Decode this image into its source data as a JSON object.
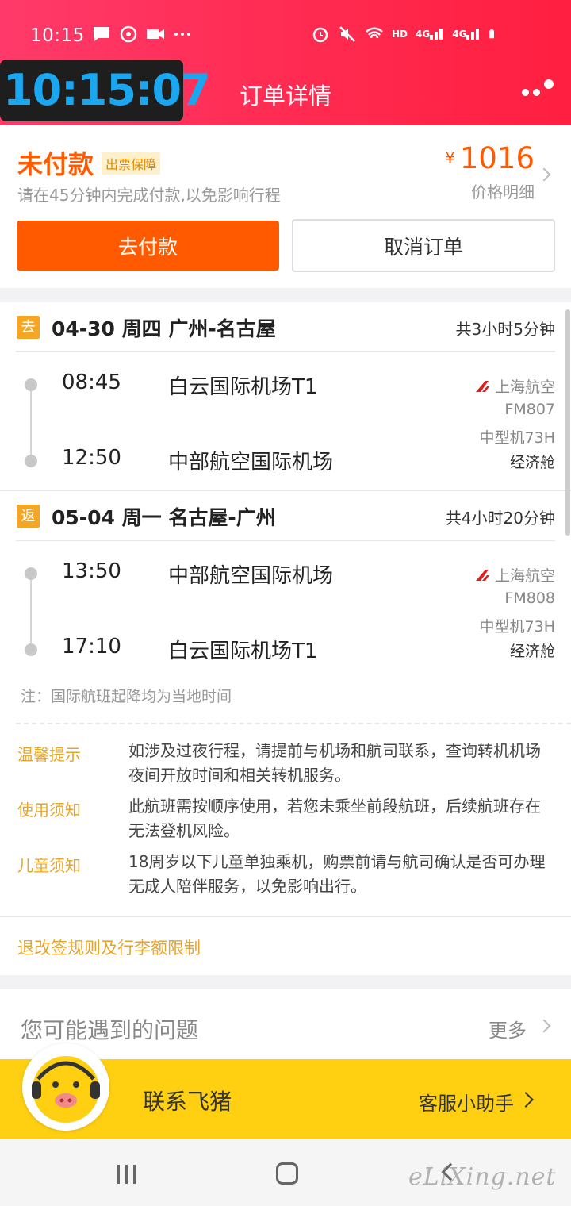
{
  "status_bar": {
    "time": "10:15",
    "network_hd": "HD",
    "network_4g_1": "4G",
    "network_4g_2": "4G"
  },
  "clock_overlay": "10:15:07",
  "header": {
    "title": "订单详情"
  },
  "order_status": {
    "title": "未付款",
    "badge": "出票保障",
    "subtitle": "请在45分钟内完成付款,以免影响行程",
    "currency": "¥",
    "price": "1016",
    "price_detail": "价格明细",
    "pay_button": "去付款",
    "cancel_button": "取消订单"
  },
  "legs": [
    {
      "tag": "去",
      "title": "04-30 周四 广州-名古屋",
      "duration": "共3小时5分钟",
      "depart_time": "08:45",
      "depart_airport": "白云国际机场T1",
      "arrive_time": "12:50",
      "arrive_airport": "中部航空国际机场",
      "airline": "上海航空",
      "flight_no": "FM807",
      "aircraft": "中型机73H",
      "cabin": "经济舱"
    },
    {
      "tag": "返",
      "title": "05-04 周一 名古屋-广州",
      "duration": "共4小时20分钟",
      "depart_time": "13:50",
      "depart_airport": "中部航空国际机场",
      "arrive_time": "17:10",
      "arrive_airport": "白云国际机场T1",
      "airline": "上海航空",
      "flight_no": "FM808",
      "aircraft": "中型机73H",
      "cabin": "经济舱"
    }
  ],
  "note": "注：国际航班起降均为当地时间",
  "tips": [
    {
      "label": "温馨提示",
      "text": "如涉及过夜行程，请提前与机场和航司联系，查询转机机场夜间开放时间和相关转机服务。"
    },
    {
      "label": "使用须知",
      "text": "此航班需按顺序使用，若您未乘坐前段航班，后续航班存在无法登机风险。"
    },
    {
      "label": "儿童须知",
      "text": "18周岁以下儿童单独乘机，购票前请与航司确认是否可办理无成人陪伴服务，以免影响出行。"
    }
  ],
  "rules_link": "退改签规则及行李额限制",
  "faq": {
    "title": "您可能遇到的问题",
    "more": "更多"
  },
  "contact": {
    "label": "联系飞猪",
    "assistant": "客服小助手"
  },
  "watermark": "eLiXing.net",
  "colors": {
    "accent": "#ff5a00",
    "header": "#ff2a50",
    "tip": "#e5a52a",
    "contact_bg": "#ffd012"
  }
}
